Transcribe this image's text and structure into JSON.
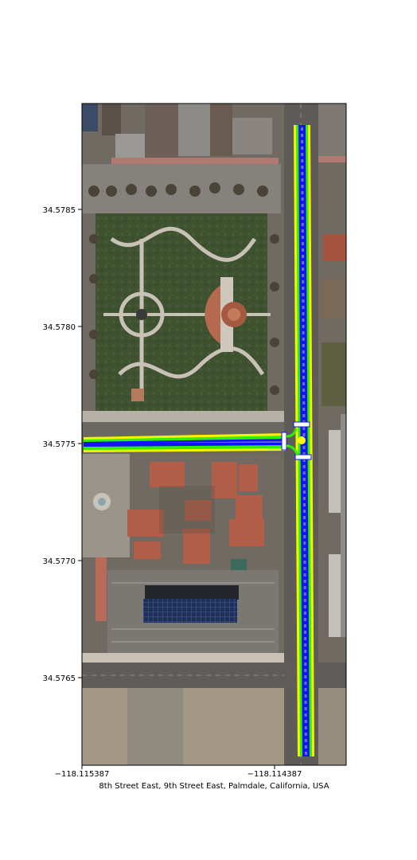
{
  "caption": "8th Street East, 9th Street East, Palmdale, California, USA",
  "axes": {
    "x_ticks": [
      "−118.115387",
      "−118.114387"
    ],
    "y_ticks": [
      "34.5785",
      "34.5780",
      "34.5775",
      "34.5770",
      "34.5765"
    ]
  },
  "colors": {
    "lane_outer": "#f5f500",
    "lane_mid": "#2ef000",
    "lane_inner": "#1212ff",
    "centerline": "#b8b8b8"
  }
}
